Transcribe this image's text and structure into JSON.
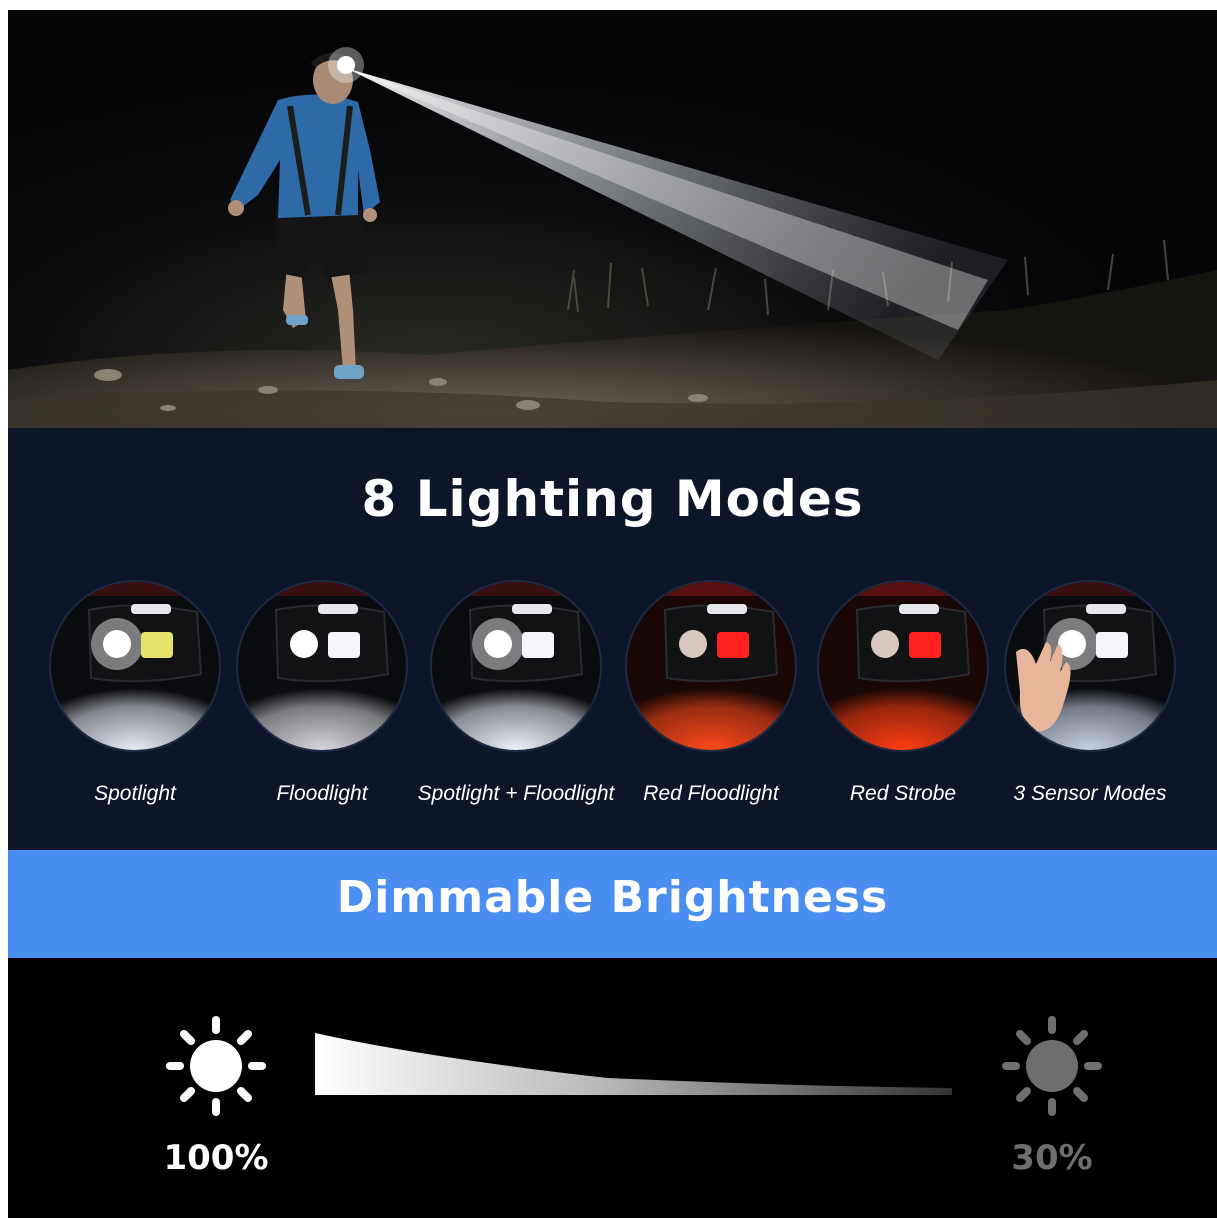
{
  "modes_section": {
    "title": "8 Lighting Modes",
    "items": [
      {
        "label": "Spotlight",
        "beam": "#e8ecf6",
        "theme": "white"
      },
      {
        "label": "Floodlight",
        "beam": "#d8d8dc",
        "theme": "white"
      },
      {
        "label": "Spotlight + Floodlight",
        "beam": "#eef2fa",
        "theme": "white"
      },
      {
        "label": "Red Floodlight",
        "beam": "#ff4a1c",
        "theme": "red"
      },
      {
        "label": "Red Strobe",
        "beam": "#ff3e14",
        "theme": "red"
      },
      {
        "label": "3 Sensor Modes",
        "beam": "#c8d2e6",
        "theme": "sensor"
      }
    ]
  },
  "dimmable_section": {
    "title": "Dimmable Brightness",
    "max_label": "100%",
    "min_label": "30%"
  },
  "colors": {
    "modes_bg": "#0d1629",
    "banner_blue": "#4a8ef1",
    "bright_icon": "#ffffff",
    "dim_icon": "#6e6e6e"
  },
  "icons": {
    "bright": "sun-icon",
    "dim": "sun-icon"
  }
}
